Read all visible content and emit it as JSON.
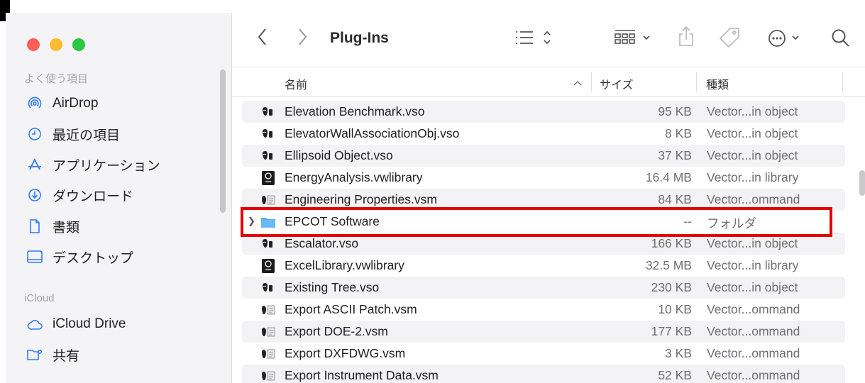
{
  "toolbar": {
    "title": "Plug-Ins"
  },
  "sidebar": {
    "favorites_header": "よく使う項目",
    "favorites": [
      {
        "label": "AirDrop",
        "icon": "airdrop-icon"
      },
      {
        "label": "最近の項目",
        "icon": "clock-icon"
      },
      {
        "label": "アプリケーション",
        "icon": "applications-icon"
      },
      {
        "label": "ダウンロード",
        "icon": "download-icon"
      },
      {
        "label": "書類",
        "icon": "document-icon"
      },
      {
        "label": "デスクトップ",
        "icon": "desktop-icon"
      }
    ],
    "icloud_header": "iCloud",
    "icloud": [
      {
        "label": "iCloud Drive",
        "icon": "cloud-icon"
      },
      {
        "label": "共有",
        "icon": "shared-folder-icon"
      }
    ]
  },
  "columns": {
    "name": "名前",
    "size": "サイズ",
    "kind": "種類"
  },
  "files": [
    {
      "name": "Elevation Benchmark.vso",
      "size": "95 KB",
      "kind": "Vector...in object",
      "icon": "vso-icon"
    },
    {
      "name": "ElevatorWallAssociationObj.vso",
      "size": "8 KB",
      "kind": "Vector...in object",
      "icon": "vso-icon"
    },
    {
      "name": "Ellipsoid Object.vso",
      "size": "37 KB",
      "kind": "Vector...in object",
      "icon": "vso-icon"
    },
    {
      "name": "EnergyAnalysis.vwlibrary",
      "size": "16.4 MB",
      "kind": "Vector...in library",
      "icon": "library-icon"
    },
    {
      "name": "Engineering Properties.vsm",
      "size": "84 KB",
      "kind": "Vector...ommand",
      "icon": "vsm-icon"
    },
    {
      "name": "EPCOT Software",
      "size": "--",
      "kind": "フォルダ",
      "icon": "folder-icon"
    },
    {
      "name": "Escalator.vso",
      "size": "166 KB",
      "kind": "Vector...in object",
      "icon": "vso-icon"
    },
    {
      "name": "ExcelLibrary.vwlibrary",
      "size": "32.5 MB",
      "kind": "Vector...in library",
      "icon": "library-icon"
    },
    {
      "name": "Existing Tree.vso",
      "size": "230 KB",
      "kind": "Vector...in object",
      "icon": "vso-icon"
    },
    {
      "name": "Export ASCII Patch.vsm",
      "size": "10 KB",
      "kind": "Vector...ommand",
      "icon": "vsm-icon"
    },
    {
      "name": "Export DOE-2.vsm",
      "size": "177 KB",
      "kind": "Vector...ommand",
      "icon": "vsm-icon"
    },
    {
      "name": "Export DXFDWG.vsm",
      "size": "3 KB",
      "kind": "Vector...ommand",
      "icon": "vsm-icon"
    },
    {
      "name": "Export Instrument Data.vsm",
      "size": "52 KB",
      "kind": "Vector...ommand",
      "icon": "vsm-icon"
    }
  ],
  "colors": {
    "highlight_border": "#e50000",
    "folder": "#5aaef0",
    "close": "#ff5f57",
    "minimize": "#febc2e",
    "zoom": "#28c840"
  }
}
